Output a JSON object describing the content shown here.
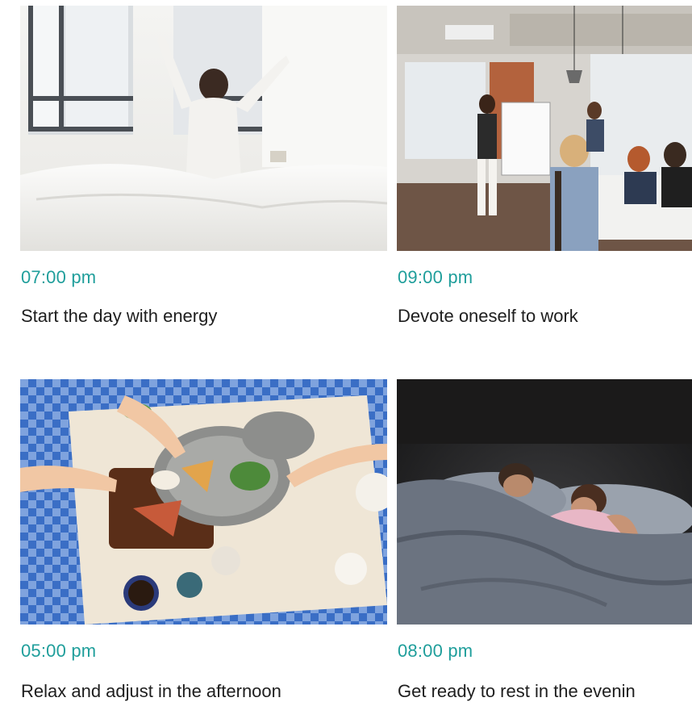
{
  "cards": [
    {
      "time": "07:00 pm",
      "caption": "Start the day with energy",
      "photo": "morning-bedroom-photo"
    },
    {
      "time": "09:00 pm",
      "caption": "Devote oneself to work",
      "photo": "office-meeting-photo"
    },
    {
      "time": "05:00 pm",
      "caption": "Relax and adjust in the afternoon",
      "photo": "picnic-food-photo"
    },
    {
      "time": "08:00 pm",
      "caption": "Get ready to rest in the evenin",
      "photo": "night-sleeping-photo"
    }
  ],
  "colors": {
    "time_accent": "#1f9e9b",
    "caption_text": "#1e1e1e",
    "background": "#ffffff"
  }
}
